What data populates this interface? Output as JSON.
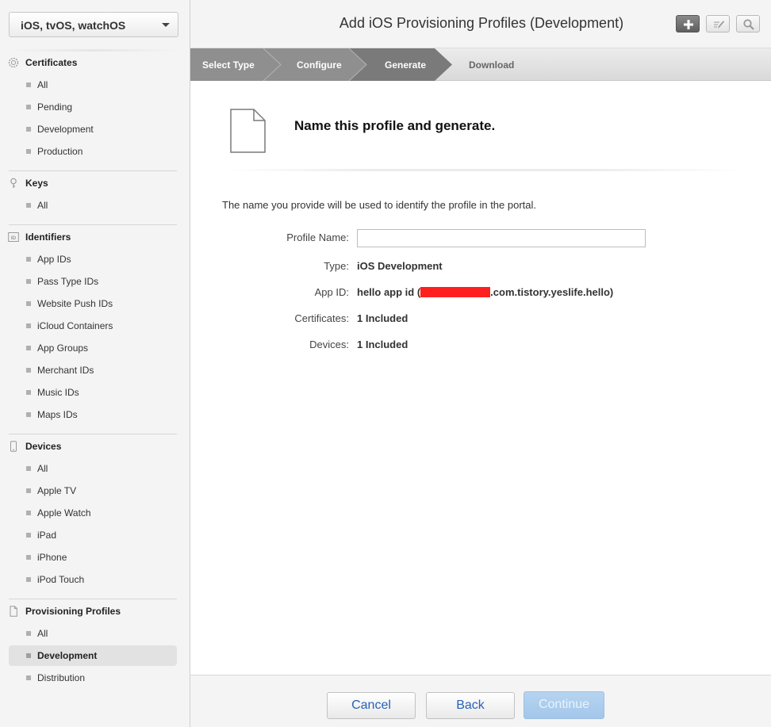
{
  "sidebar": {
    "platform": "iOS, tvOS, watchOS",
    "sections": {
      "certificates": {
        "title": "Certificates",
        "icon": "gear-badge-icon",
        "items": [
          "All",
          "Pending",
          "Development",
          "Production"
        ]
      },
      "keys": {
        "title": "Keys",
        "icon": "key-icon",
        "items": [
          "All"
        ]
      },
      "identifiers": {
        "title": "Identifiers",
        "icon": "id-icon",
        "items": [
          "App IDs",
          "Pass Type IDs",
          "Website Push IDs",
          "iCloud Containers",
          "App Groups",
          "Merchant IDs",
          "Music IDs",
          "Maps IDs"
        ]
      },
      "devices": {
        "title": "Devices",
        "icon": "device-icon",
        "items": [
          "All",
          "Apple TV",
          "Apple Watch",
          "iPad",
          "iPhone",
          "iPod Touch"
        ]
      },
      "profiles": {
        "title": "Provisioning Profiles",
        "icon": "document-icon",
        "items": [
          "All",
          "Development",
          "Distribution"
        ],
        "selected": "Development"
      }
    }
  },
  "header": {
    "title": "Add iOS Provisioning Profiles (Development)",
    "tools": [
      "add-icon",
      "edit-icon",
      "search-icon"
    ]
  },
  "steps": {
    "items": [
      "Select Type",
      "Configure",
      "Generate",
      "Download"
    ],
    "current": "Generate",
    "colors": {
      "done": "#8f8f8f",
      "current": "#7a7a7a",
      "pending": "#dcdcdc"
    }
  },
  "main": {
    "heading": "Name this profile and generate.",
    "intro": "The name you provide will be used to identify the profile in the portal.",
    "fields": {
      "profile_name": {
        "label": "Profile Name:",
        "value": ""
      },
      "type": {
        "label": "Type:",
        "value": "iOS Development"
      },
      "app_id": {
        "label": "App ID:",
        "prefix": "hello app id (",
        "suffix": ".com.tistory.yeslife.hello)"
      },
      "certificates": {
        "label": "Certificates:",
        "value": "1 Included"
      },
      "devices": {
        "label": "Devices:",
        "value": "1 Included"
      }
    }
  },
  "footer": {
    "cancel": "Cancel",
    "back": "Back",
    "continue": "Continue"
  }
}
